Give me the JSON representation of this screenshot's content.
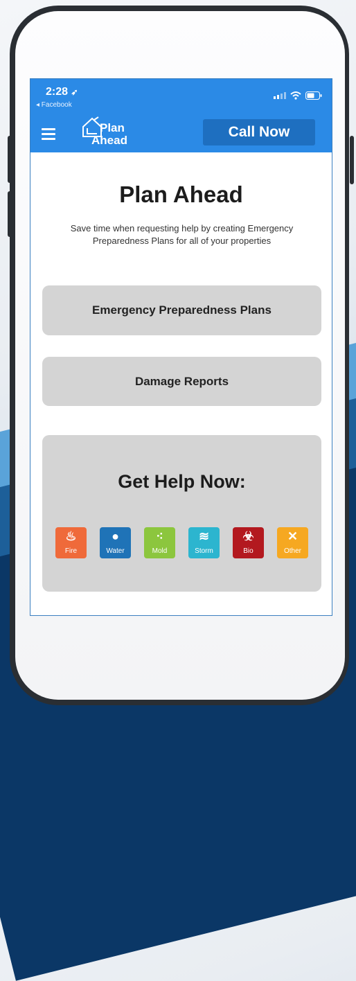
{
  "status_bar": {
    "time": "2:28",
    "back_app": "◂ Facebook"
  },
  "app_bar": {
    "logo_line1": "Plan",
    "logo_line2": "Ahead",
    "call_button": "Call Now"
  },
  "main": {
    "title": "Plan Ahead",
    "subtitle": "Save time when requesting help by creating Emergency Preparedness Plans for all of your properties",
    "cards": [
      {
        "label": "Emergency Preparedness Plans"
      },
      {
        "label": "Damage Reports"
      }
    ]
  },
  "help": {
    "title": "Get Help Now:",
    "categories": [
      {
        "label": "Fire",
        "icon": "flame-icon",
        "color": "#ef6a3a"
      },
      {
        "label": "Water",
        "icon": "water-drop-icon",
        "color": "#1f73b7"
      },
      {
        "label": "Mold",
        "icon": "mold-spores-icon",
        "color": "#8cc63e"
      },
      {
        "label": "Storm",
        "icon": "tornado-icon",
        "color": "#2cb5cf"
      },
      {
        "label": "Bio",
        "icon": "biohazard-icon",
        "color": "#b3191f"
      },
      {
        "label": "Other",
        "icon": "tools-icon",
        "color": "#f6a821"
      }
    ]
  },
  "colors": {
    "app_bar": "#2b8ae6",
    "call_button": "#1e6fc0",
    "card": "#d4d4d4"
  }
}
